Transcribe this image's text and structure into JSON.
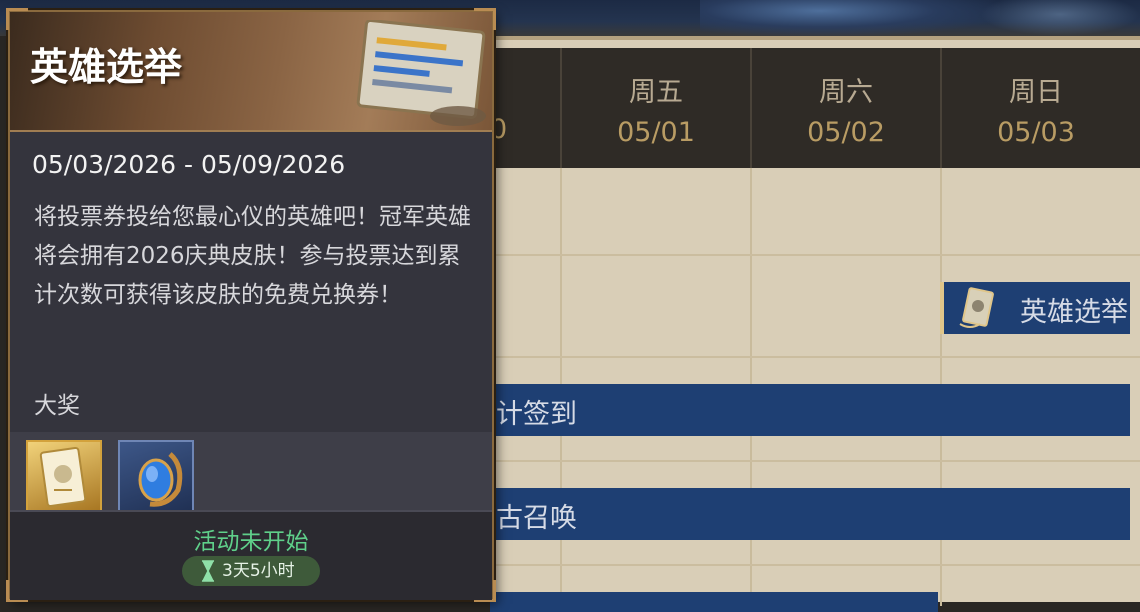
{
  "calendar": {
    "days": [
      {
        "name": "周五",
        "date": "05/01"
      },
      {
        "name": "周六",
        "date": "05/02"
      },
      {
        "name": "周日",
        "date": "05/03"
      }
    ],
    "partial_date": "0",
    "events": {
      "hero": "英雄选举",
      "sign": "计签到",
      "summon": "古召唤"
    }
  },
  "popup": {
    "title": "英雄选举",
    "date_range": "05/03/2026 - 05/09/2026",
    "description": "将投票券投给您最心仪的英雄吧！冠军英雄将会拥有2026庆典皮肤！参与投票达到累计次数可获得该皮肤的免费兑换券！",
    "prize_label": "大奖",
    "prizes": [
      {
        "icon": "voting-ticket-icon"
      },
      {
        "icon": "blue-gem-icon"
      }
    ],
    "status": "活动未开始",
    "timer_icon": "hourglass-icon",
    "timer": "3天5小时",
    "colors": {
      "status": "#5fd08a",
      "event_bar": "#1e3f73",
      "frame": "#8a6a3e"
    }
  }
}
